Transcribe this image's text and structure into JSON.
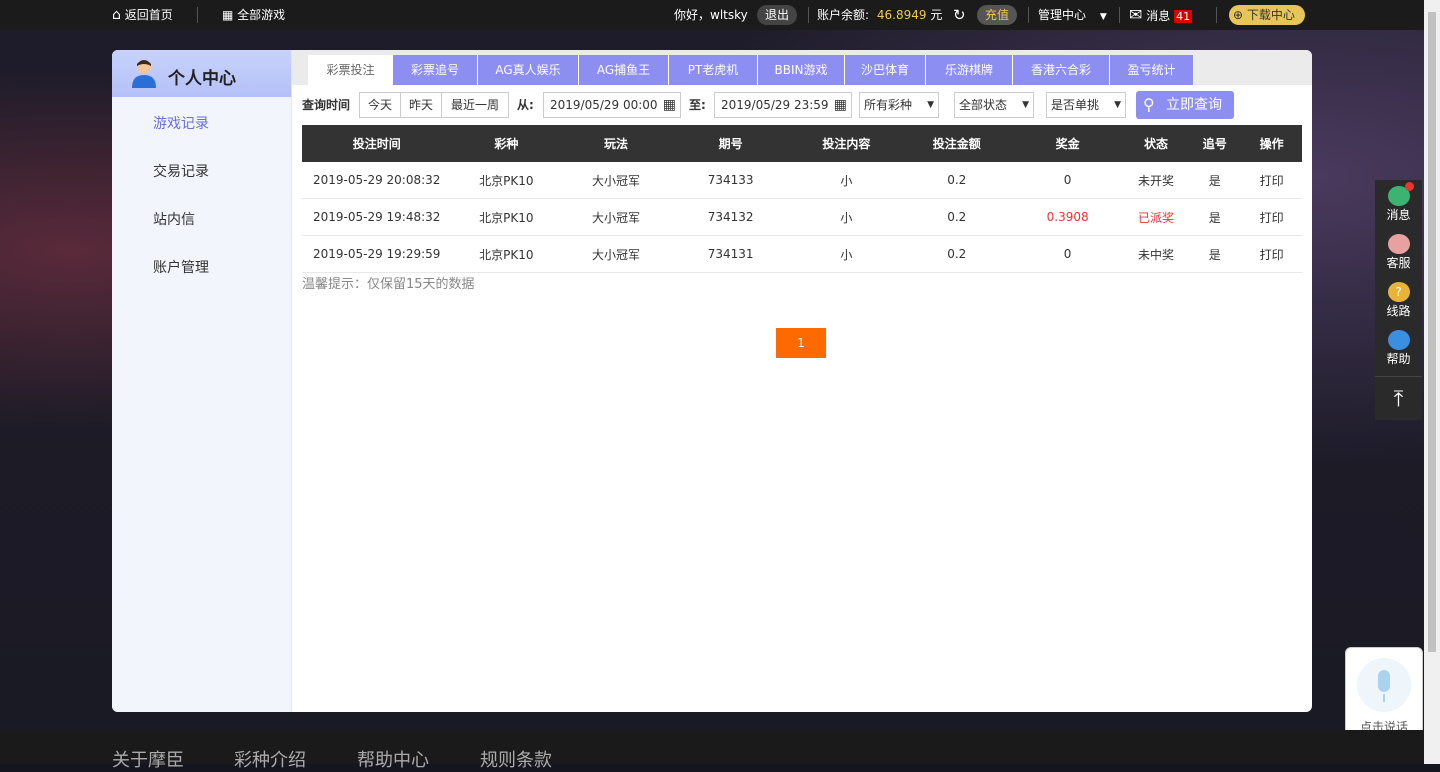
{
  "topbar": {
    "home": "返回首页",
    "all_games": "全部游戏",
    "greeting": "你好，wltsky",
    "logout": "退出",
    "balance_label": "账户余额:",
    "balance_value": "46.8949",
    "balance_unit": "元",
    "recharge": "充值",
    "admin": "管理中心",
    "messages": "消息",
    "messages_count": "41",
    "download": "下载中心"
  },
  "sidebar": {
    "title": "个人中心",
    "items": [
      {
        "label": "游戏记录"
      },
      {
        "label": "交易记录"
      },
      {
        "label": "站内信"
      },
      {
        "label": "账户管理"
      }
    ]
  },
  "tabs": [
    "彩票投注",
    "彩票追号",
    "AG真人娱乐",
    "AG捕鱼王",
    "PT老虎机",
    "BBIN游戏",
    "沙巴体育",
    "乐游棋牌",
    "香港六合彩",
    "盈亏统计"
  ],
  "filters": {
    "query_time": "查询时间",
    "today": "今天",
    "yesterday": "昨天",
    "last_week": "最近一周",
    "from_label": "从:",
    "from_value": "2019/05/29 00:00",
    "to_label": "至:",
    "to_value": "2019/05/29 23:59",
    "lottery": "所有彩种",
    "status": "全部状态",
    "single": "是否单挑",
    "search": "立即查询"
  },
  "table": {
    "headers": [
      "投注时间",
      "彩种",
      "玩法",
      "期号",
      "投注内容",
      "投注金额",
      "奖金",
      "状态",
      "追号",
      "操作"
    ],
    "rows": [
      [
        "2019-05-29 20:08:32",
        "北京PK10",
        "大小冠军",
        "734133",
        "小",
        "0.2",
        "0",
        "未开奖",
        "是",
        "打印"
      ],
      [
        "2019-05-29 19:48:32",
        "北京PK10",
        "大小冠军",
        "734132",
        "小",
        "0.2",
        "0.3908",
        "已派奖",
        "是",
        "打印"
      ],
      [
        "2019-05-29 19:29:59",
        "北京PK10",
        "大小冠军",
        "734131",
        "小",
        "0.2",
        "0",
        "未中奖",
        "是",
        "打印"
      ]
    ]
  },
  "tip": "温馨提示：仅保留15天的数据",
  "pagination": {
    "page": "1"
  },
  "right_sidebar": {
    "messages": "消息",
    "service": "客服",
    "route": "线路",
    "help": "帮助"
  },
  "voice": {
    "label": "点击说话"
  },
  "footer": [
    "关于摩臣",
    "彩种介绍",
    "帮助中心",
    "规则条款"
  ],
  "colors": {
    "accent": "#8c8ef2",
    "page_button": "#ff6a00",
    "red": "#e33333",
    "balance": "#f2c94c"
  }
}
